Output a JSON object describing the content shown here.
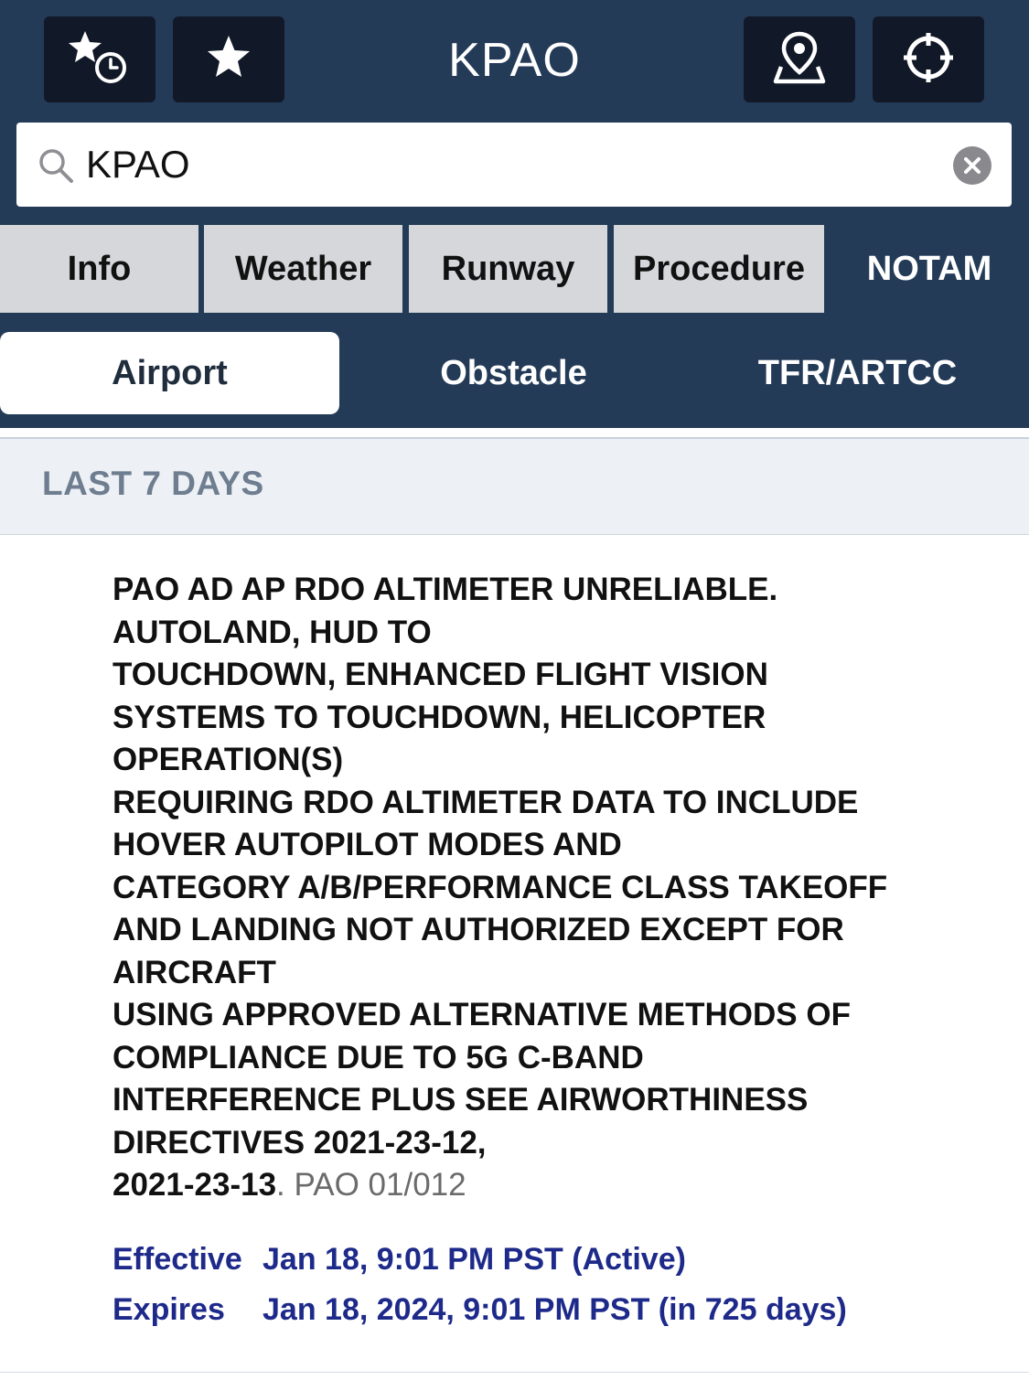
{
  "header": {
    "title": "KPAO"
  },
  "search": {
    "value": "KPAO"
  },
  "tabs": [
    {
      "label": "Info"
    },
    {
      "label": "Weather"
    },
    {
      "label": "Runway"
    },
    {
      "label": "Procedure"
    },
    {
      "label": "NOTAM"
    }
  ],
  "active_tab": "NOTAM",
  "segments": [
    {
      "label": "Airport"
    },
    {
      "label": "Obstacle"
    },
    {
      "label": "TFR/ARTCC"
    }
  ],
  "active_segment": "Airport",
  "section": {
    "title": "LAST 7 DAYS"
  },
  "notam": {
    "lines": [
      "PAO AD AP RDO ALTIMETER UNRELIABLE.",
      "AUTOLAND, HUD TO",
      "TOUCHDOWN, ENHANCED FLIGHT VISION",
      "SYSTEMS TO TOUCHDOWN, HELICOPTER",
      "OPERATION(S)",
      "REQUIRING RDO ALTIMETER DATA TO INCLUDE",
      "HOVER AUTOPILOT MODES AND",
      "CATEGORY A/B/PERFORMANCE CLASS TAKEOFF",
      "AND LANDING NOT AUTHORIZED EXCEPT FOR",
      "AIRCRAFT",
      "USING APPROVED ALTERNATIVE METHODS OF",
      "COMPLIANCE DUE TO 5G C-BAND",
      "INTERFERENCE PLUS SEE AIRWORTHINESS",
      "DIRECTIVES 2021-23-12,"
    ],
    "last_line": "2021-23-13",
    "ref": ". PAO 01/012",
    "effective_label": "Effective",
    "effective_value": "Jan 18, 9:01 PM PST (Active)",
    "expires_label": "Expires",
    "expires_value": "Jan 18, 2024, 9:01 PM PST (in 725 days)"
  },
  "colors": {
    "header_bg": "#243b58",
    "tab_bg": "#d5d7db",
    "date_text": "#1e2a8a",
    "section_bg": "#edf1f5"
  },
  "icons": [
    "recent-favorites-icon",
    "star-icon",
    "map-pin-icon",
    "crosshair-icon",
    "search-icon",
    "clear-icon"
  ]
}
